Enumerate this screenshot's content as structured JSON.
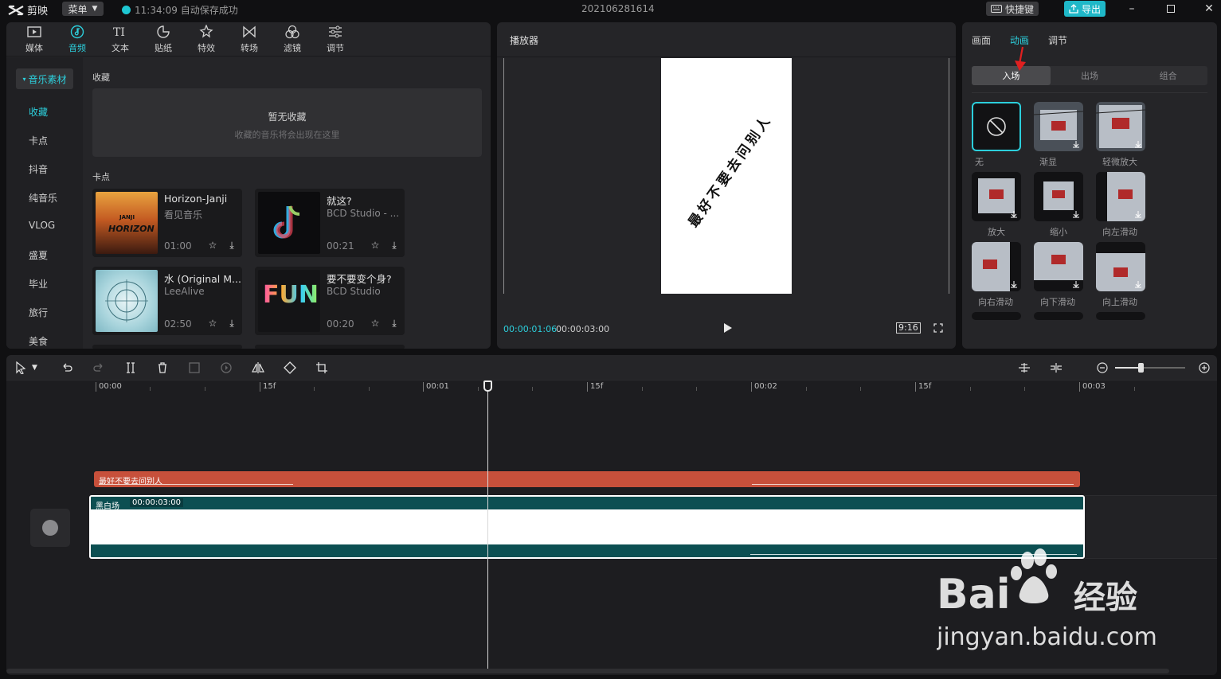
{
  "titlebar": {
    "app_name": "剪映",
    "menu_label": "菜单",
    "autosave_text": "11:34:09 自动保存成功",
    "project_name": "202106281614",
    "shortcut_label": "快捷键",
    "export_label": "导出"
  },
  "media_toolbar": [
    {
      "label": "媒体",
      "icon": "media-icon"
    },
    {
      "label": "音频",
      "icon": "audio-icon",
      "active": true
    },
    {
      "label": "文本",
      "icon": "text-icon"
    },
    {
      "label": "贴纸",
      "icon": "sticker-icon"
    },
    {
      "label": "特效",
      "icon": "effects-icon"
    },
    {
      "label": "转场",
      "icon": "transition-icon"
    },
    {
      "label": "滤镜",
      "icon": "filter-icon"
    },
    {
      "label": "调节",
      "icon": "adjust-icon"
    }
  ],
  "sidebar": {
    "category": "音乐素材",
    "items": [
      "收藏",
      "卡点",
      "抖音",
      "纯音乐",
      "VLOG",
      "盛夏",
      "毕业",
      "旅行",
      "美食"
    ]
  },
  "favorites": {
    "heading": "收藏",
    "empty_title": "暂无收藏",
    "empty_desc": "收藏的音乐将会出现在这里"
  },
  "beat_section": {
    "heading": "卡点",
    "tracks": [
      {
        "name": "Horizon-Janji",
        "artist": "看见音乐",
        "duration": "01:00",
        "cover_text": "HORIZON",
        "cover_sub": "JANJI"
      },
      {
        "name": "就这?",
        "artist": "BCD Studio - ...",
        "duration": "00:21"
      },
      {
        "name": "水 (Original M...",
        "artist": "LeeAlive",
        "duration": "02:50"
      },
      {
        "name": "要不要变个身?",
        "artist": "BCD Studio",
        "duration": "00:20",
        "cover_text": "FUN"
      }
    ]
  },
  "player": {
    "title": "播放器",
    "video_text": "最好不要去问别人",
    "current_time": "00:00:01:06",
    "total_time": "00:00:03:00",
    "ratio": "9:16"
  },
  "properties": {
    "tabs": [
      "画面",
      "动画",
      "调节"
    ],
    "active_tab": "动画",
    "segments": [
      "入场",
      "出场",
      "组合"
    ],
    "active_segment": "入场",
    "animations": [
      "无",
      "渐显",
      "轻微放大",
      "放大",
      "缩小",
      "向左滑动",
      "向右滑动",
      "向下滑动",
      "向上滑动"
    ]
  },
  "timeline": {
    "ruler": [
      "00:00",
      "15f",
      "00:01",
      "15f",
      "00:02",
      "15f",
      "00:03"
    ],
    "text_clip_label": "最好不要去问别人",
    "video_clip_label": "黑白场",
    "video_clip_duration": "00:00:03:00"
  },
  "watermark": {
    "brand": "Bai",
    "brand2": "经验",
    "url": "jingyan.baidu.com"
  },
  "colors": {
    "accent": "#2ccfdc",
    "text_clip": "#c7503b",
    "video_clip": "#0c4f52",
    "arrow": "#e02020"
  }
}
